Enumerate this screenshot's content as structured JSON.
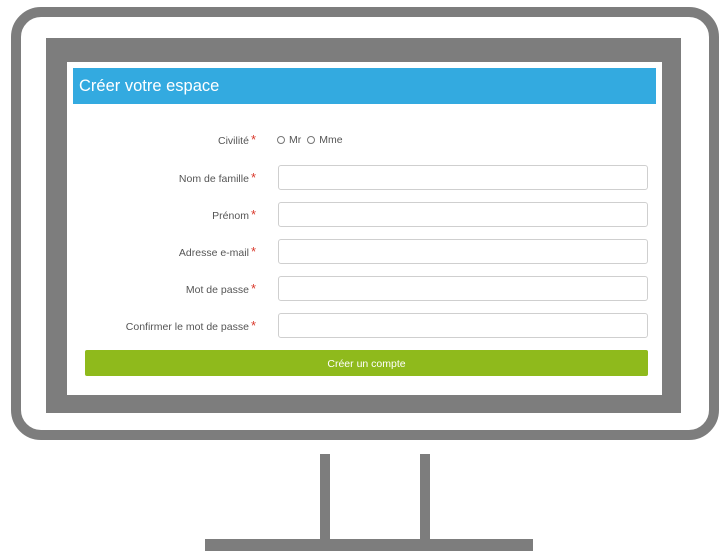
{
  "form": {
    "title": "Créer votre espace",
    "required_marker": "*",
    "civility": {
      "label": "Civilité",
      "options": [
        "Mr",
        "Mme"
      ]
    },
    "fields": [
      {
        "label": "Nom de famille",
        "value": ""
      },
      {
        "label": "Prénom",
        "value": ""
      },
      {
        "label": "Adresse e-mail",
        "value": ""
      },
      {
        "label": "Mot de passe",
        "value": ""
      },
      {
        "label": "Confirmer le mot de passe",
        "value": ""
      }
    ],
    "submit_label": "Créer un compte"
  },
  "colors": {
    "header": "#33aae0",
    "submit": "#8fba1c",
    "required": "#d9392c",
    "monitor": "#7d7d7d"
  }
}
